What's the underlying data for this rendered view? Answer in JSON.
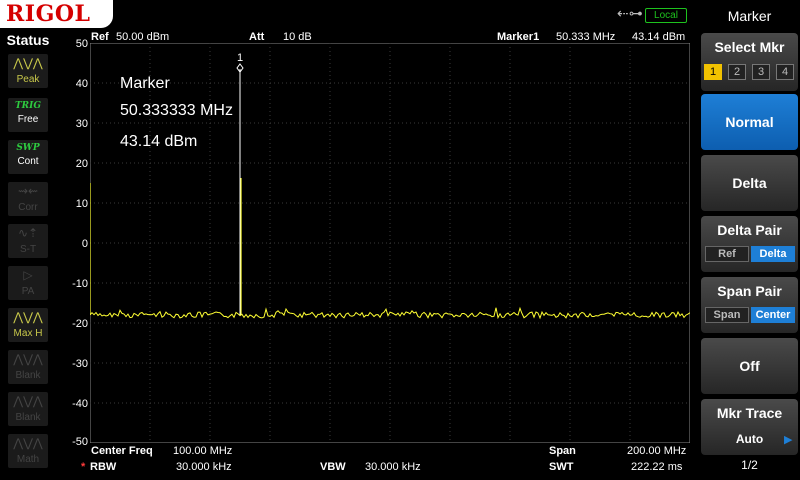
{
  "brand": {
    "logo": "RIGOL",
    "usb_icon": "usb-icon",
    "local": "Local"
  },
  "status": {
    "title": "Status",
    "items": [
      {
        "icon": "peak-icon",
        "label": "Peak",
        "state": "on"
      },
      {
        "title": "TRIG",
        "label": "Free",
        "state": "on2"
      },
      {
        "title": "SWP",
        "label": "Cont",
        "state": "on2"
      },
      {
        "icon": "corr-icon",
        "label": "Corr",
        "state": "off"
      },
      {
        "icon": "st-icon",
        "label": "S-T",
        "state": "off"
      },
      {
        "icon": "pa-icon",
        "label": "PA",
        "state": "off"
      },
      {
        "icon": "maxhold-icon",
        "label": "Max H",
        "state": "on"
      },
      {
        "icon": "blank-icon",
        "label": "Blank",
        "state": "off"
      },
      {
        "icon": "blank-icon",
        "label": "Blank",
        "state": "off"
      },
      {
        "icon": "math-icon",
        "label": "Math",
        "state": "off"
      }
    ]
  },
  "header": {
    "ref_label": "Ref",
    "ref_value": "50.00 dBm",
    "att_label": "Att",
    "att_value": "10 dB",
    "marker_label": "Marker1",
    "marker_freq": "50.333 MHz",
    "marker_amp": "43.14 dBm"
  },
  "y_axis": {
    "ticks": [
      "50",
      "40",
      "30",
      "20",
      "10",
      "0",
      "-10",
      "-20",
      "-30",
      "-40",
      "-50"
    ]
  },
  "marker_readout": {
    "title": "Marker",
    "freq": "50.333333 MHz",
    "amp": "43.14 dBm",
    "tag": "1"
  },
  "footer": {
    "center_label": "Center Freq",
    "center_value": "100.00 MHz",
    "span_label": "Span",
    "span_value": "200.00 MHz",
    "rbw_star": "*",
    "rbw_label": "RBW",
    "rbw_value": "30.000 kHz",
    "vbw_label": "VBW",
    "vbw_value": "30.000 kHz",
    "swt_label": "SWT",
    "swt_value": "222.22 ms"
  },
  "menu": {
    "title": "Marker",
    "select_mkr": "Select Mkr",
    "numbers": [
      "1",
      "2",
      "3",
      "4"
    ],
    "active_number": "1",
    "normal": "Normal",
    "delta": "Delta",
    "delta_pair": "Delta Pair",
    "delta_pair_ref": "Ref",
    "delta_pair_delta": "Delta",
    "span_pair": "Span Pair",
    "span_pair_span": "Span",
    "span_pair_center": "Center",
    "off": "Off",
    "mkr_trace": "Mkr Trace",
    "mkr_trace_value": "Auto",
    "page": "1/2"
  },
  "colors": {
    "trace": "#ffff33",
    "grid": "#3a3a3a",
    "accent": "#1e7fd6",
    "logo_red": "#d50000"
  }
}
